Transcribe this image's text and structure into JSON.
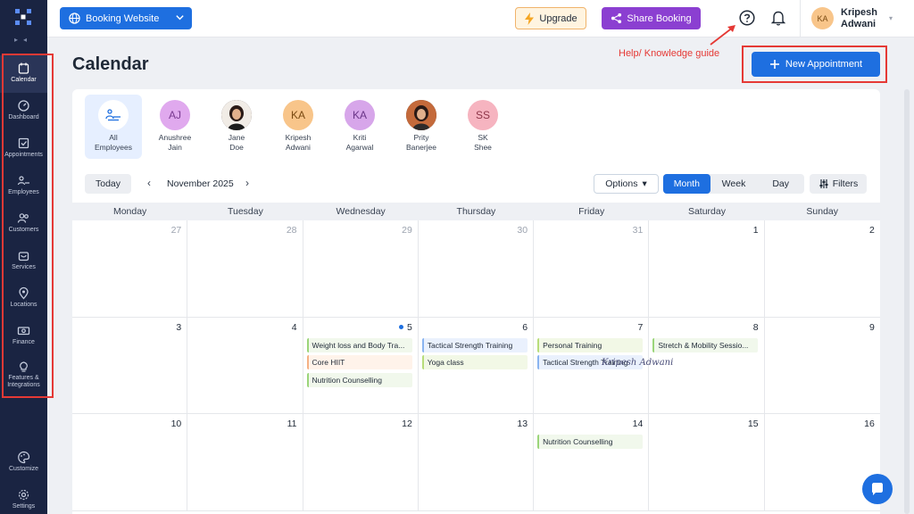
{
  "sidebar": {
    "items": [
      {
        "label": "Calendar",
        "icon": "calendar-icon",
        "active": true
      },
      {
        "label": "Dashboard",
        "icon": "dashboard-icon"
      },
      {
        "label": "Appointments",
        "icon": "appointments-icon"
      },
      {
        "label": "Employees",
        "icon": "employees-icon"
      },
      {
        "label": "Customers",
        "icon": "customers-icon"
      },
      {
        "label": "Services",
        "icon": "services-icon"
      },
      {
        "label": "Locations",
        "icon": "location-pin-icon"
      },
      {
        "label": "Finance",
        "icon": "finance-icon"
      },
      {
        "label": "Features &",
        "label2": "Integrations",
        "icon": "bulb-icon"
      },
      {
        "label": "Customize",
        "icon": "palette-icon"
      },
      {
        "label": "Settings",
        "icon": "gear-icon"
      }
    ]
  },
  "topbar": {
    "site_button": "Booking Website",
    "upgrade": "Upgrade",
    "share": "Share Booking",
    "user_initials": "KA",
    "user_first": "Kripesh",
    "user_last": "Adwani"
  },
  "page": {
    "title": "Calendar",
    "help_note": "Help/ Knowledge guide",
    "new_appointment": "New Appointment"
  },
  "employees": [
    {
      "initials": "",
      "name1": "All",
      "name2": "Employees",
      "active": true
    },
    {
      "initials": "AJ",
      "name1": "Anushree",
      "name2": "Jain",
      "bg": "#e0a9ee",
      "fg": "#7a3a91"
    },
    {
      "initials": "",
      "name1": "Jane",
      "name2": "Doe",
      "photo": true
    },
    {
      "initials": "KA",
      "name1": "Kripesh",
      "name2": "Adwani",
      "bg": "#f8c58a",
      "fg": "#7a4a12"
    },
    {
      "initials": "KA",
      "name1": "Kriti",
      "name2": "Agarwal",
      "bg": "#d7a6ea",
      "fg": "#6a3588"
    },
    {
      "initials": "",
      "name1": "Prity",
      "name2": "Banerjee",
      "photo": true
    },
    {
      "initials": "SS",
      "name1": "SK",
      "name2": "Shee",
      "bg": "#f6b4c0",
      "fg": "#8e3548"
    }
  ],
  "toolbar": {
    "today": "Today",
    "month_label": "November 2025",
    "options": "Options",
    "views": [
      "Month",
      "Week",
      "Day"
    ],
    "active_view": "Month",
    "filters": "Filters"
  },
  "weekdays": [
    "Monday",
    "Tuesday",
    "Wednesday",
    "Thursday",
    "Friday",
    "Saturday",
    "Sunday"
  ],
  "weeks": [
    [
      {
        "day": "27",
        "muted": true
      },
      {
        "day": "28",
        "muted": true
      },
      {
        "day": "29",
        "muted": true
      },
      {
        "day": "30",
        "muted": true
      },
      {
        "day": "31",
        "muted": true
      },
      {
        "day": "1"
      },
      {
        "day": "2"
      }
    ],
    [
      {
        "day": "3"
      },
      {
        "day": "4"
      },
      {
        "day": "5",
        "today": true,
        "events": [
          {
            "title": "Weight loss and Body Tra...",
            "color": "green"
          },
          {
            "title": "Core HIIT",
            "color": "orange"
          },
          {
            "title": "Nutrition Counselling",
            "color": "green"
          }
        ]
      },
      {
        "day": "6",
        "events": [
          {
            "title": "Tactical Strength Training",
            "color": "blue"
          },
          {
            "title": "Yoga class",
            "color": "lime"
          }
        ]
      },
      {
        "day": "7",
        "events": [
          {
            "title": "Personal Training",
            "color": "lime"
          },
          {
            "title": "Tactical Strength Training",
            "color": "blue"
          }
        ]
      },
      {
        "day": "8",
        "events": [
          {
            "title": "Stretch & Mobility Sessio...",
            "color": "green"
          }
        ]
      },
      {
        "day": "9"
      }
    ],
    [
      {
        "day": "10"
      },
      {
        "day": "11"
      },
      {
        "day": "12"
      },
      {
        "day": "13"
      },
      {
        "day": "14",
        "events": [
          {
            "title": "Nutrition Counselling",
            "color": "green"
          }
        ]
      },
      {
        "day": "15"
      },
      {
        "day": "16"
      }
    ]
  ],
  "signature": "Kripesh Adwani",
  "colors": {
    "primary": "#1e6fe0",
    "sidebar": "#1a2442",
    "share": "#8b3fd1",
    "annotation": "#e53935"
  }
}
